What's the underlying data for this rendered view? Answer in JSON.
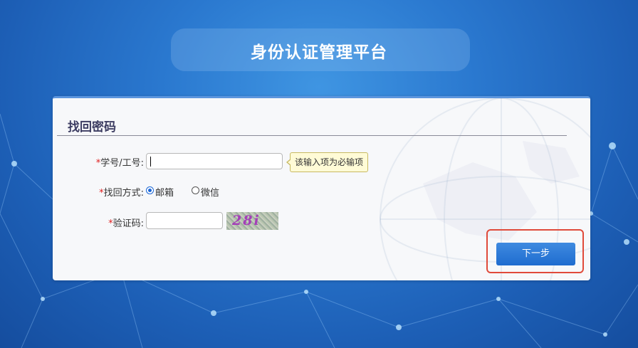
{
  "header": {
    "title": "身份认证管理平台"
  },
  "form": {
    "title": "找回密码",
    "required_mark": "*",
    "id_label": "学号/工号:",
    "id_value": "",
    "validation_tip": "该输入项为必输项",
    "method_label": "找回方式:",
    "method_options": [
      {
        "label": "邮箱",
        "checked": true
      },
      {
        "label": "微信",
        "checked": false
      }
    ],
    "captcha_label": "验证码:",
    "captcha_value": "",
    "captcha_text": "28i",
    "next_label": "下一步"
  },
  "colors": {
    "accent": "#1f6ccf",
    "highlight": "#e04a3a",
    "required": "#e02020"
  }
}
